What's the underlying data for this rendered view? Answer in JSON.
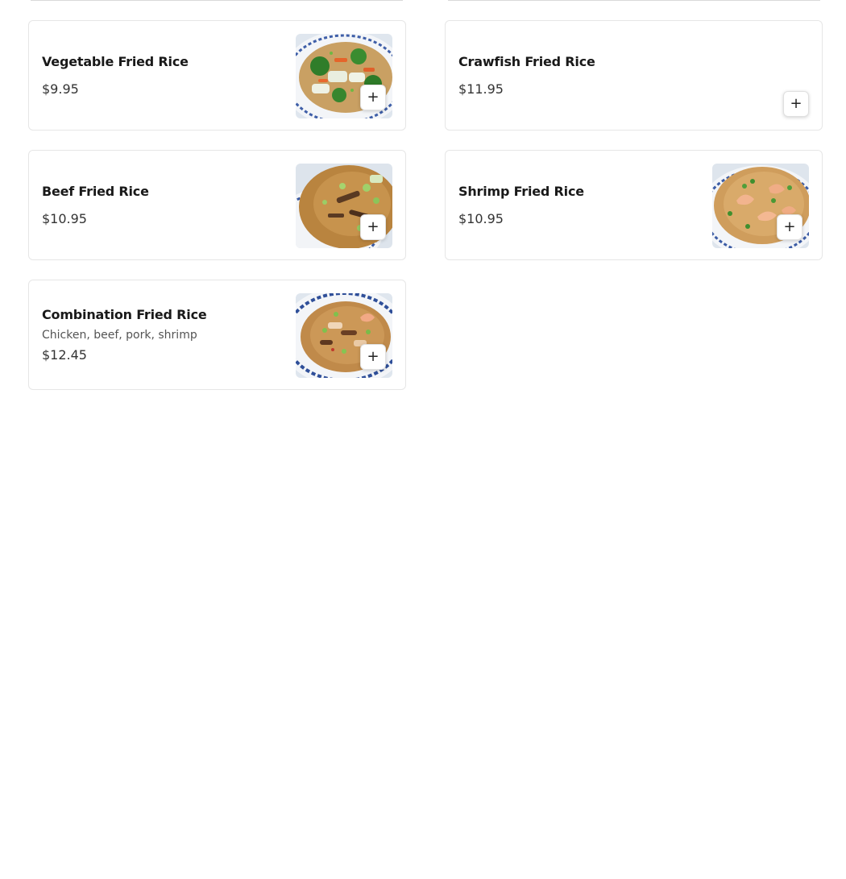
{
  "menu": {
    "items": [
      {
        "name": "Vegetable Fried Rice",
        "price": "$9.95",
        "icon": "vegetable-fried-rice-photo"
      },
      {
        "name": "Crawfish Fried Rice",
        "price": "$11.95"
      },
      {
        "name": "Beef Fried Rice",
        "price": "$10.95",
        "icon": "beef-fried-rice-photo"
      },
      {
        "name": "Shrimp Fried Rice",
        "price": "$10.95",
        "icon": "shrimp-fried-rice-photo"
      },
      {
        "name": "Combination Fried Rice",
        "description": "Chicken, beef, pork, shrimp",
        "price": "$12.45",
        "icon": "combination-fried-rice-photo"
      }
    ],
    "add_button_icon": "plus-icon",
    "add_symbol": "+"
  },
  "colors": {
    "card_border": "#e6e6e6",
    "text_primary": "#191919",
    "text_secondary": "#545454"
  }
}
